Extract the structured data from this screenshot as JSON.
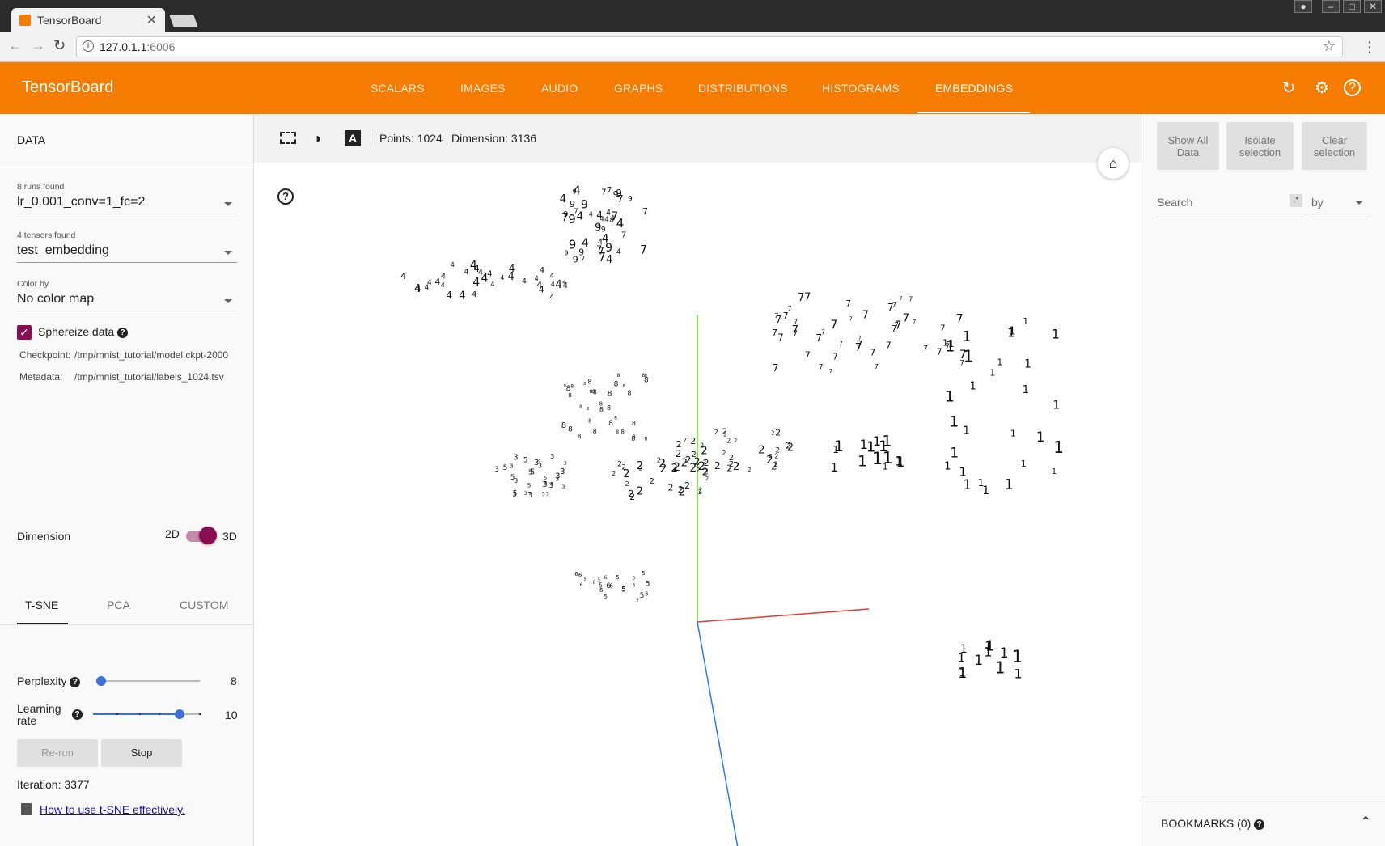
{
  "browser": {
    "tab_title": "TensorBoard",
    "url_host": "127.0.1.1",
    "url_port": ":6006"
  },
  "header": {
    "brand": "TensorBoard",
    "tabs": [
      "SCALARS",
      "IMAGES",
      "AUDIO",
      "GRAPHS",
      "DISTRIBUTIONS",
      "HISTOGRAMS",
      "EMBEDDINGS"
    ],
    "active_tab": "EMBEDDINGS",
    "icons": [
      "refresh-icon",
      "settings-icon",
      "help-icon"
    ]
  },
  "left": {
    "section_title": "DATA",
    "runs": {
      "label": "8 runs found",
      "value": "lr_0.001_conv=1_fc=2"
    },
    "tensors": {
      "label": "4 tensors found",
      "value": "test_embedding"
    },
    "color_by": {
      "label": "Color by",
      "value": "No color map"
    },
    "sphereize": {
      "label": "Sphereize data",
      "checked": true
    },
    "checkpoint": {
      "label": "Checkpoint:",
      "value": "/tmp/mnist_tutorial/model.ckpt-2000"
    },
    "metadata": {
      "label": "Metadata:",
      "value": "/tmp/mnist_tutorial/labels_1024.tsv"
    },
    "projection_tabs": [
      "T-SNE",
      "PCA",
      "CUSTOM"
    ],
    "active_projection": "T-SNE",
    "dimension": {
      "label": "Dimension",
      "option_2d": "2D",
      "option_3d": "3D",
      "value": "3D"
    },
    "perplexity": {
      "label": "Perplexity",
      "value": "8",
      "fraction": 0.03
    },
    "learning_rate": {
      "label_line1": "Learning",
      "label_line2": "rate",
      "value": "10",
      "fraction": 0.8
    },
    "rerun_label": "Re-run",
    "stop_label": "Stop",
    "iteration": "Iteration: 3377",
    "howto_link": "How to use t-SNE effectively."
  },
  "center": {
    "points": "Points: 1024",
    "dimension": "Dimension: 3136",
    "axis_colors": {
      "x": "#e53935",
      "y": "#66dd22",
      "z": "#2979ff"
    }
  },
  "right": {
    "show_all": [
      "Show All",
      "Data"
    ],
    "isolate": [
      "Isolate",
      "selection"
    ],
    "clear": [
      "Clear",
      "selection"
    ],
    "search_placeholder": "Search",
    "regex_label": ".*",
    "by_label": "by",
    "bookmarks": "BOOKMARKS (0)"
  }
}
